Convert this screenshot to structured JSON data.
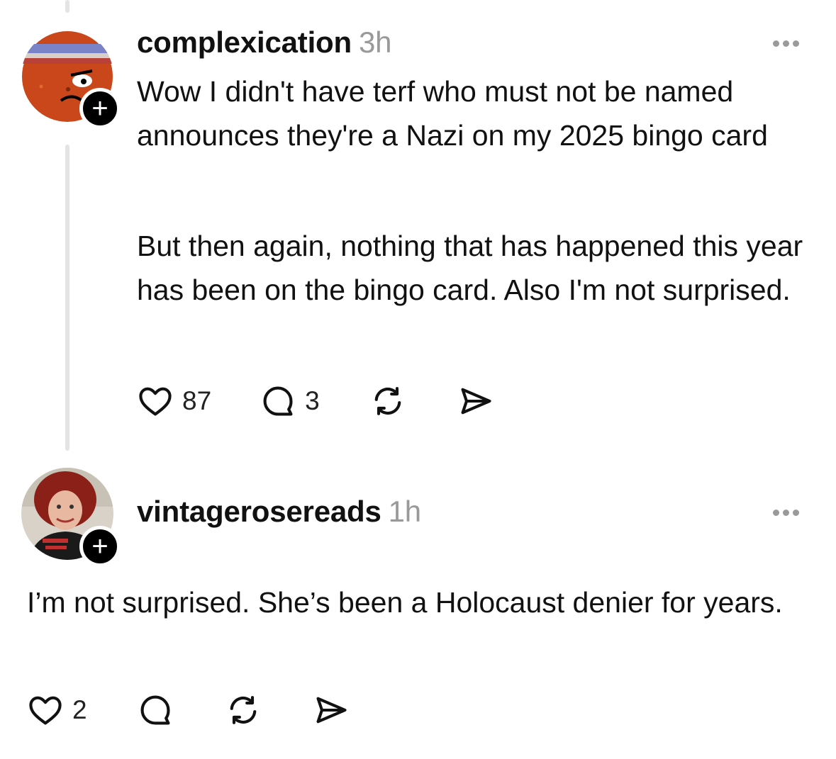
{
  "posts": [
    {
      "username": "complexication",
      "time": "3h",
      "paragraphs": [
        "Wow I didn't have terf who must not be named announces they're a Nazi on my 2025 bingo card",
        "But then again, nothing that has happened this year has been on the bingo card. Also I'm not surprised."
      ],
      "likes": "87",
      "replies": "3",
      "follow_label": "+",
      "avatar_icon": "cartoon-meatball-avatar"
    },
    {
      "username": "vintagerosereads",
      "time": "1h",
      "paragraphs": [
        "I’m not surprised. She’s been a Holocaust denier for years."
      ],
      "likes": "2",
      "replies": "",
      "follow_label": "+",
      "avatar_icon": "red-haired-woman-avatar"
    }
  ],
  "icons": {
    "like": "heart-icon",
    "reply": "comment-icon",
    "repost": "repost-icon",
    "share": "send-icon",
    "more": "more-options-icon"
  },
  "colors": {
    "text": "#111111",
    "muted": "#999999",
    "thread_line": "#e4e4e4",
    "badge": "#000000"
  }
}
